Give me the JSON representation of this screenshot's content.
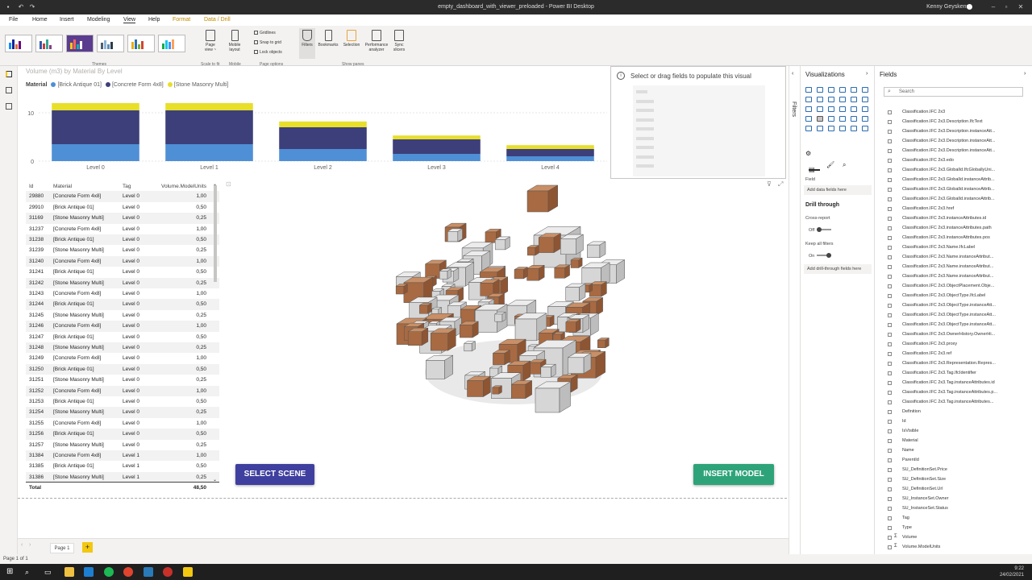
{
  "window": {
    "title": "empty_dashboard_with_viewer_preloaded - Power BI Desktop",
    "user": "Kenny Geyskens"
  },
  "menu": {
    "items": [
      "File",
      "Home",
      "Insert",
      "Modeling",
      "View",
      "Help",
      "Format",
      "Data / Drill"
    ],
    "active": "View"
  },
  "ribbon": {
    "themes_label": "Themes",
    "scale_label": "Page view ~",
    "scale_group": "Scale to fit",
    "mobile_label": "Mobile layout",
    "mobile_group": "Mobile",
    "checkboxes": [
      "Gridlines",
      "Snap to grid",
      "Lock objects"
    ],
    "page_options_group": "Page options",
    "pane_buttons": [
      "Filters",
      "Bookmarks",
      "Selection",
      "Performance analyzer",
      "Sync slicers"
    ],
    "show_panes_group": "Show panes"
  },
  "chart_data": {
    "type": "bar",
    "stacked": true,
    "title": "Volume (m3) by Material By Level",
    "legend_title": "Material",
    "categories": [
      "Level 0",
      "Level 1",
      "Level 2",
      "Level 3",
      "Level 4"
    ],
    "series": [
      {
        "name": "[Brick Antique 01]",
        "color": "#4f8fd6",
        "values": [
          3.5,
          3.5,
          2.5,
          1.5,
          1.0
        ]
      },
      {
        "name": "[Concrete Form 4x8]",
        "color": "#3d3f7a",
        "values": [
          7.0,
          7.0,
          4.5,
          3.0,
          1.5
        ]
      },
      {
        "name": "[Stone Masonry Multi]",
        "color": "#e7df2a",
        "values": [
          1.5,
          1.5,
          1.2,
          0.8,
          0.8
        ]
      }
    ],
    "yticks": [
      0,
      10
    ],
    "ylim": [
      0,
      13
    ],
    "grid": true,
    "legend_position": "top-left"
  },
  "table": {
    "columns": [
      "Id",
      "Material",
      "Tag",
      "Volume.ModelUnits"
    ],
    "rows": [
      [
        "29880",
        "[Concrete Form 4x8]",
        "Level 0",
        "1,00"
      ],
      [
        "29910",
        "[Brick Antique 01]",
        "Level 0",
        "0,50"
      ],
      [
        "31169",
        "[Stone Masonry Multi]",
        "Level 0",
        "0,25"
      ],
      [
        "31237",
        "[Concrete Form 4x8]",
        "Level 0",
        "1,00"
      ],
      [
        "31238",
        "[Brick Antique 01]",
        "Level 0",
        "0,50"
      ],
      [
        "31239",
        "[Stone Masonry Multi]",
        "Level 0",
        "0,25"
      ],
      [
        "31240",
        "[Concrete Form 4x8]",
        "Level 0",
        "1,00"
      ],
      [
        "31241",
        "[Brick Antique 01]",
        "Level 0",
        "0,50"
      ],
      [
        "31242",
        "[Stone Masonry Multi]",
        "Level 0",
        "0,25"
      ],
      [
        "31243",
        "[Concrete Form 4x8]",
        "Level 0",
        "1,00"
      ],
      [
        "31244",
        "[Brick Antique 01]",
        "Level 0",
        "0,50"
      ],
      [
        "31245",
        "[Stone Masonry Multi]",
        "Level 0",
        "0,25"
      ],
      [
        "31246",
        "[Concrete Form 4x8]",
        "Level 0",
        "1,00"
      ],
      [
        "31247",
        "[Brick Antique 01]",
        "Level 0",
        "0,50"
      ],
      [
        "31248",
        "[Stone Masonry Multi]",
        "Level 0",
        "0,25"
      ],
      [
        "31249",
        "[Concrete Form 4x8]",
        "Level 0",
        "1,00"
      ],
      [
        "31250",
        "[Brick Antique 01]",
        "Level 0",
        "0,50"
      ],
      [
        "31251",
        "[Stone Masonry Multi]",
        "Level 0",
        "0,25"
      ],
      [
        "31252",
        "[Concrete Form 4x8]",
        "Level 0",
        "1,00"
      ],
      [
        "31253",
        "[Brick Antique 01]",
        "Level 0",
        "0,50"
      ],
      [
        "31254",
        "[Stone Masonry Multi]",
        "Level 0",
        "0,25"
      ],
      [
        "31255",
        "[Concrete Form 4x8]",
        "Level 0",
        "1,00"
      ],
      [
        "31256",
        "[Brick Antique 01]",
        "Level 0",
        "0,50"
      ],
      [
        "31257",
        "[Stone Masonry Multi]",
        "Level 0",
        "0,25"
      ],
      [
        "31384",
        "[Concrete Form 4x8]",
        "Level 1",
        "1,00"
      ],
      [
        "31385",
        "[Brick Antique 01]",
        "Level 1",
        "0,50"
      ],
      [
        "31386",
        "[Stone Masonry Multi]",
        "Level 1",
        "0,25"
      ]
    ],
    "total_label": "Total",
    "total_value": "48,50"
  },
  "viewer": {
    "select_label": "SELECT SCENE",
    "insert_label": "INSERT MODEL",
    "select_color": "#3f3f9f",
    "insert_color": "#2ea37a"
  },
  "empty_visual": {
    "message": "Select or drag fields to populate this visual"
  },
  "pages": {
    "tab": "Page 1",
    "add": "+",
    "status": "Page 1 of 1"
  },
  "filters_pane": {
    "label": "Filters"
  },
  "viz_pane": {
    "title": "Visualizations",
    "field_label": "Field",
    "add_fields": "Add data fields here",
    "drill_title": "Drill through",
    "cross_report": "Cross-report",
    "off": "Off",
    "keep_filters": "Keep all filters",
    "on": "On",
    "add_drill": "Add drill-through fields here"
  },
  "fields_pane": {
    "title": "Fields",
    "search_placeholder": "Search",
    "fields": [
      {
        "name": "Classification.IFC 2x3",
        "sigma": false
      },
      {
        "name": "Classification.IFC 2x3.Description.IfcText",
        "sigma": false
      },
      {
        "name": "Classification.IFC 2x3.Description.instanceAtt...",
        "sigma": false
      },
      {
        "name": "Classification.IFC 2x3.Description.instanceAtt...",
        "sigma": false
      },
      {
        "name": "Classification.IFC 2x3.Description.instanceAtt...",
        "sigma": false
      },
      {
        "name": "Classification.IFC 2x3.edo",
        "sigma": false
      },
      {
        "name": "Classification.IFC 2x3.GlobalId.IfcGloballyUni...",
        "sigma": false
      },
      {
        "name": "Classification.IFC 2x3.GlobalId.instanceAttrib...",
        "sigma": false
      },
      {
        "name": "Classification.IFC 2x3.GlobalId.instanceAttrib...",
        "sigma": false
      },
      {
        "name": "Classification.IFC 2x3.GlobalId.instanceAttrib...",
        "sigma": false
      },
      {
        "name": "Classification.IFC 2x3.href",
        "sigma": false
      },
      {
        "name": "Classification.IFC 2x3.instanceAttributes.id",
        "sigma": false
      },
      {
        "name": "Classification.IFC 2x3.instanceAttributes.path",
        "sigma": false
      },
      {
        "name": "Classification.IFC 2x3.instanceAttributes.pos",
        "sigma": false
      },
      {
        "name": "Classification.IFC 2x3.Name.IfcLabel",
        "sigma": false
      },
      {
        "name": "Classification.IFC 2x3.Name.instanceAttribut...",
        "sigma": false
      },
      {
        "name": "Classification.IFC 2x3.Name.instanceAttribut...",
        "sigma": false
      },
      {
        "name": "Classification.IFC 2x3.Name.instanceAttribut...",
        "sigma": false
      },
      {
        "name": "Classification.IFC 2x3.ObjectPlacement.Obje...",
        "sigma": false
      },
      {
        "name": "Classification.IFC 2x3.ObjectType.IfcLabel",
        "sigma": false
      },
      {
        "name": "Classification.IFC 2x3.ObjectType.instanceAtt...",
        "sigma": false
      },
      {
        "name": "Classification.IFC 2x3.ObjectType.instanceAtt...",
        "sigma": false
      },
      {
        "name": "Classification.IFC 2x3.ObjectType.instanceAtt...",
        "sigma": false
      },
      {
        "name": "Classification.IFC 2x3.OwnerHistory.OwnerHi...",
        "sigma": false
      },
      {
        "name": "Classification.IFC 2x3.proxy",
        "sigma": false
      },
      {
        "name": "Classification.IFC 2x3.ref",
        "sigma": false
      },
      {
        "name": "Classification.IFC 2x3.Representation.Repres...",
        "sigma": false
      },
      {
        "name": "Classification.IFC 2x3.Tag.IfcIdentifier",
        "sigma": false
      },
      {
        "name": "Classification.IFC 2x3.Tag.instanceAttributes.id",
        "sigma": false
      },
      {
        "name": "Classification.IFC 2x3.Tag.instanceAttributes.p...",
        "sigma": false
      },
      {
        "name": "Classification.IFC 2x3.Tag.instanceAttributes...",
        "sigma": false
      },
      {
        "name": "Definition",
        "sigma": false
      },
      {
        "name": "Id",
        "sigma": false
      },
      {
        "name": "IsVisible",
        "sigma": false
      },
      {
        "name": "Material",
        "sigma": false
      },
      {
        "name": "Name",
        "sigma": false
      },
      {
        "name": "ParentId",
        "sigma": false
      },
      {
        "name": "SU_DefinitionSet.Price",
        "sigma": false
      },
      {
        "name": "SU_DefinitionSet.Size",
        "sigma": false
      },
      {
        "name": "SU_DefinitionSet.Url",
        "sigma": false
      },
      {
        "name": "SU_InstanceSet.Owner",
        "sigma": false
      },
      {
        "name": "SU_InstanceSet.Status",
        "sigma": false
      },
      {
        "name": "Tag",
        "sigma": false
      },
      {
        "name": "Type",
        "sigma": false
      },
      {
        "name": "Volume",
        "sigma": true
      },
      {
        "name": "Volume.ModelUnits",
        "sigma": true
      }
    ]
  },
  "taskbar": {
    "time": "9:22",
    "date": "24/02/2021"
  }
}
